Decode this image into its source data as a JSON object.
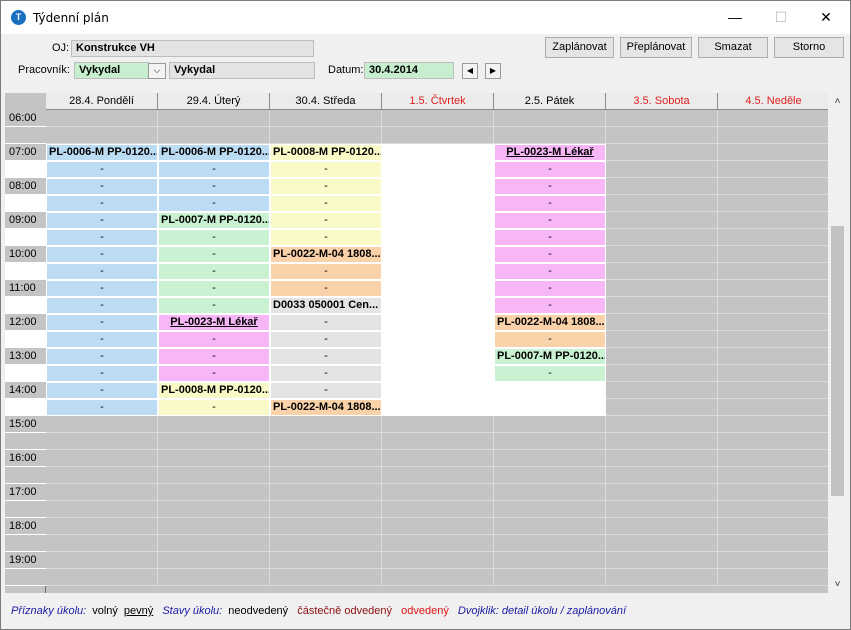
{
  "window": {
    "title": "Týdenní plán",
    "controls": {
      "minimize": "—",
      "maximize": "☐",
      "close": "✕"
    }
  },
  "form": {
    "oj_label": "OJ:",
    "oj_value": "Konstrukce VH",
    "worker_label": "Pracovník:",
    "worker_code": "Vykydal",
    "worker_name": "Vykydal",
    "date_label": "Datum:",
    "date_value": "30.4.2014"
  },
  "toolbar": {
    "plan": "Zaplánovat",
    "replan": "Přeplánovat",
    "delete": "Smazat",
    "cancel": "Storno"
  },
  "colors": {
    "blue": "#bcdcf4",
    "green": "#c8f2d2",
    "yellow": "#fafac8",
    "orange": "#fad2aa",
    "pink": "#f7b7f7",
    "gray": "#e4e4e4",
    "white": "#ffffff"
  },
  "calendar": {
    "days": [
      {
        "label": "28.4. Pondělí",
        "weekend": false
      },
      {
        "label": "29.4. Úterý",
        "weekend": false
      },
      {
        "label": "30.4. Středa",
        "weekend": false
      },
      {
        "label": "1.5. Čtvrtek",
        "weekend": true
      },
      {
        "label": "2.5. Pátek",
        "weekend": false
      },
      {
        "label": "3.5. Sobota",
        "weekend": true
      },
      {
        "label": "4.5. Neděle",
        "weekend": true
      }
    ],
    "hours": [
      "06:00",
      "07:00",
      "08:00",
      "09:00",
      "10:00",
      "11:00",
      "12:00",
      "13:00",
      "14:00",
      "15:00",
      "16:00",
      "17:00",
      "18:00",
      "19:00"
    ],
    "working_slot_start": 2,
    "working_slot_end": 17,
    "blocks": [
      {
        "day": 0,
        "start": 2,
        "end": 17,
        "color": "blue",
        "title": "PL-0006-M PP-0120..."
      },
      {
        "day": 1,
        "start": 2,
        "end": 5,
        "color": "blue",
        "title": "PL-0006-M PP-0120..."
      },
      {
        "day": 1,
        "start": 6,
        "end": 11,
        "color": "green",
        "title": "PL-0007-M PP-0120..."
      },
      {
        "day": 1,
        "start": 12,
        "end": 15,
        "color": "pink",
        "title": "PL-0023-M Lékař",
        "underline": true
      },
      {
        "day": 1,
        "start": 16,
        "end": 17,
        "color": "yellow",
        "title": "PL-0008-M PP-0120..."
      },
      {
        "day": 2,
        "start": 2,
        "end": 7,
        "color": "yellow",
        "title": "PL-0008-M PP-0120..."
      },
      {
        "day": 2,
        "start": 8,
        "end": 10,
        "color": "orange",
        "title": "PL-0022-M-04 1808..."
      },
      {
        "day": 2,
        "start": 11,
        "end": 16,
        "color": "gray",
        "title": "D0033 050001 Cen..."
      },
      {
        "day": 2,
        "start": 17,
        "end": 17,
        "color": "orange",
        "title": "PL-0022-M-04 1808..."
      },
      {
        "day": 3,
        "start": 2,
        "end": 17,
        "color": "white",
        "title": ""
      },
      {
        "day": 4,
        "start": 2,
        "end": 11,
        "color": "pink",
        "title": "PL-0023-M Lékař",
        "underline": true
      },
      {
        "day": 4,
        "start": 12,
        "end": 13,
        "color": "orange",
        "title": "PL-0022-M-04 1808..."
      },
      {
        "day": 4,
        "start": 14,
        "end": 15,
        "color": "green",
        "title": "PL-0007-M PP-0120..."
      },
      {
        "day": 4,
        "start": 16,
        "end": 17,
        "color": "white",
        "title": ""
      }
    ],
    "continuation_mark": "-"
  },
  "legend": {
    "flags_label": "Příznaky úkolu:",
    "free": "volný",
    "fixed": "pevný",
    "states_label": "Stavy úkolu:",
    "not_done": "neodvedený",
    "partial": "částečně odvedený",
    "done": "odvedený",
    "hint": "Dvojklik: detail úkolu / zaplánování"
  }
}
